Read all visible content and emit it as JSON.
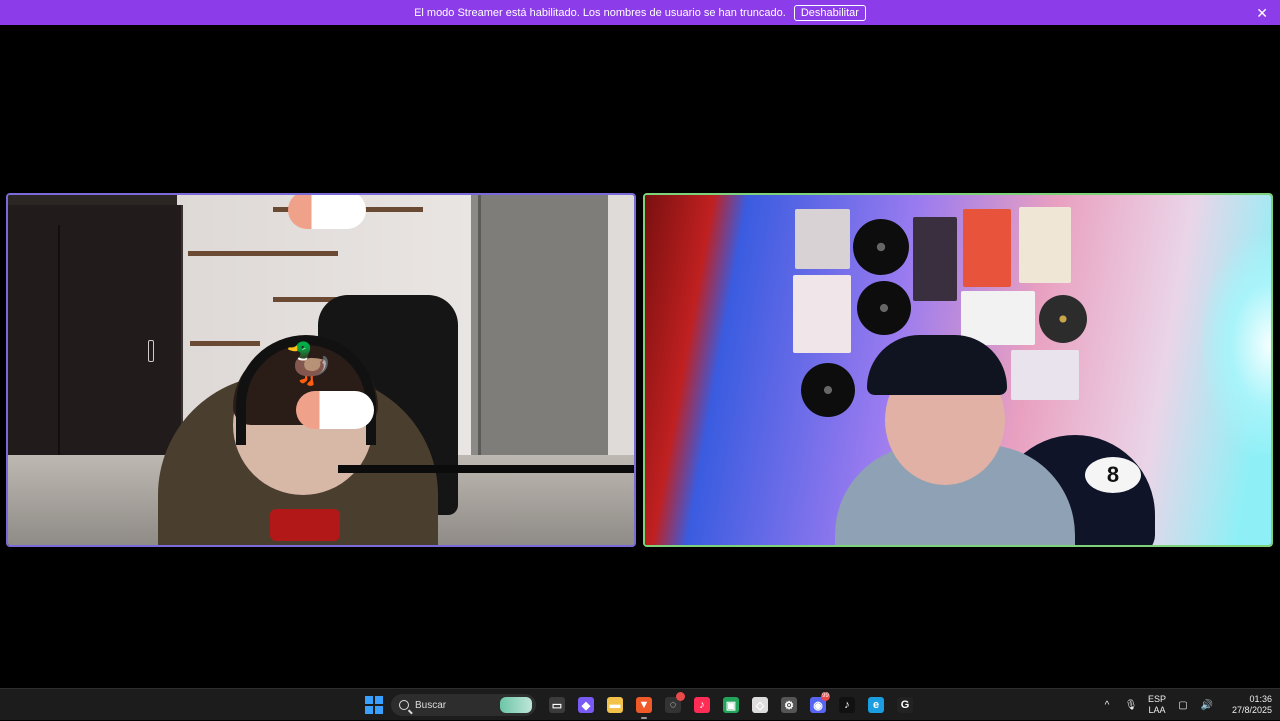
{
  "banner": {
    "message": "El modo Streamer está habilitado. Los nombres de usuario se han truncado.",
    "button_label": "Deshabilitar",
    "close_glyph": "✕",
    "color": "#8c3ce8"
  },
  "tiles": {
    "left_border_color": "#7b6bd8",
    "right_border_color": "#7ed37a",
    "right_ball_number": "8"
  },
  "taskbar": {
    "search_placeholder": "Buscar",
    "apps": [
      {
        "name": "task-view",
        "glyph": "▭",
        "color": "#3b3b3b"
      },
      {
        "name": "copilot",
        "glyph": "◆",
        "color": "#7a5af5"
      },
      {
        "name": "file-explorer",
        "glyph": "▬",
        "color": "#f2c24b"
      },
      {
        "name": "brave",
        "glyph": "▼",
        "color": "#f05a28"
      },
      {
        "name": "app-circle",
        "glyph": "◌",
        "color": "#333333",
        "badge": ""
      },
      {
        "name": "tiktok-live",
        "glyph": "♪",
        "color": "#ff2c55"
      },
      {
        "name": "app-green",
        "glyph": "▣",
        "color": "#22a55a"
      },
      {
        "name": "app-white",
        "glyph": "◇",
        "color": "#dddddd"
      },
      {
        "name": "settings",
        "glyph": "⚙",
        "color": "#555555"
      },
      {
        "name": "discord",
        "glyph": "◉",
        "color": "#5865f2",
        "badge": "99"
      },
      {
        "name": "tiktok",
        "glyph": "♪",
        "color": "#111111"
      },
      {
        "name": "edge",
        "glyph": "e",
        "color": "#1b9de2"
      },
      {
        "name": "app-g",
        "glyph": "G",
        "color": "#222222"
      }
    ],
    "tray": {
      "chevron": "^",
      "mic": "🎙",
      "lang_top": "ESP",
      "lang_bottom": "LAA",
      "network": "▢",
      "volume": "🔊",
      "time": "01:36",
      "date": "27/8/2025"
    }
  }
}
